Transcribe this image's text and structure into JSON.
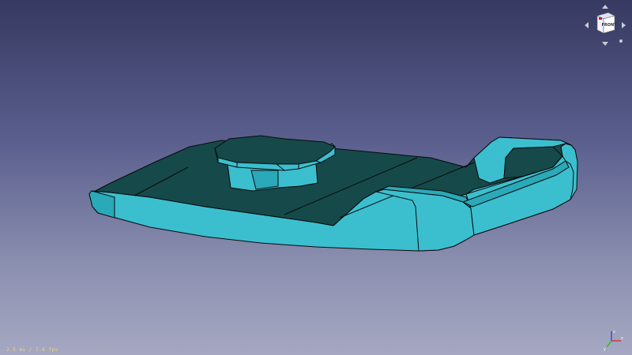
{
  "app": {
    "view_background_top": "#363960",
    "view_background_bottom": "#a6a8c2"
  },
  "model": {
    "face_color": "#3bbfcf",
    "shadow_color": "#16494a",
    "edge_color": "#0a0a0a"
  },
  "navcube": {
    "face_label": "FRONT",
    "arrow_icon": "triangle-arrows",
    "accent_color": "#d02020"
  },
  "status": {
    "fps_text": "2.5 ms / 7.8 fps"
  },
  "axis": {
    "x_label": "x",
    "y_label": "y",
    "z_label": "z",
    "x_color": "#e03030",
    "y_color": "#30c030",
    "z_color": "#3050e0"
  }
}
